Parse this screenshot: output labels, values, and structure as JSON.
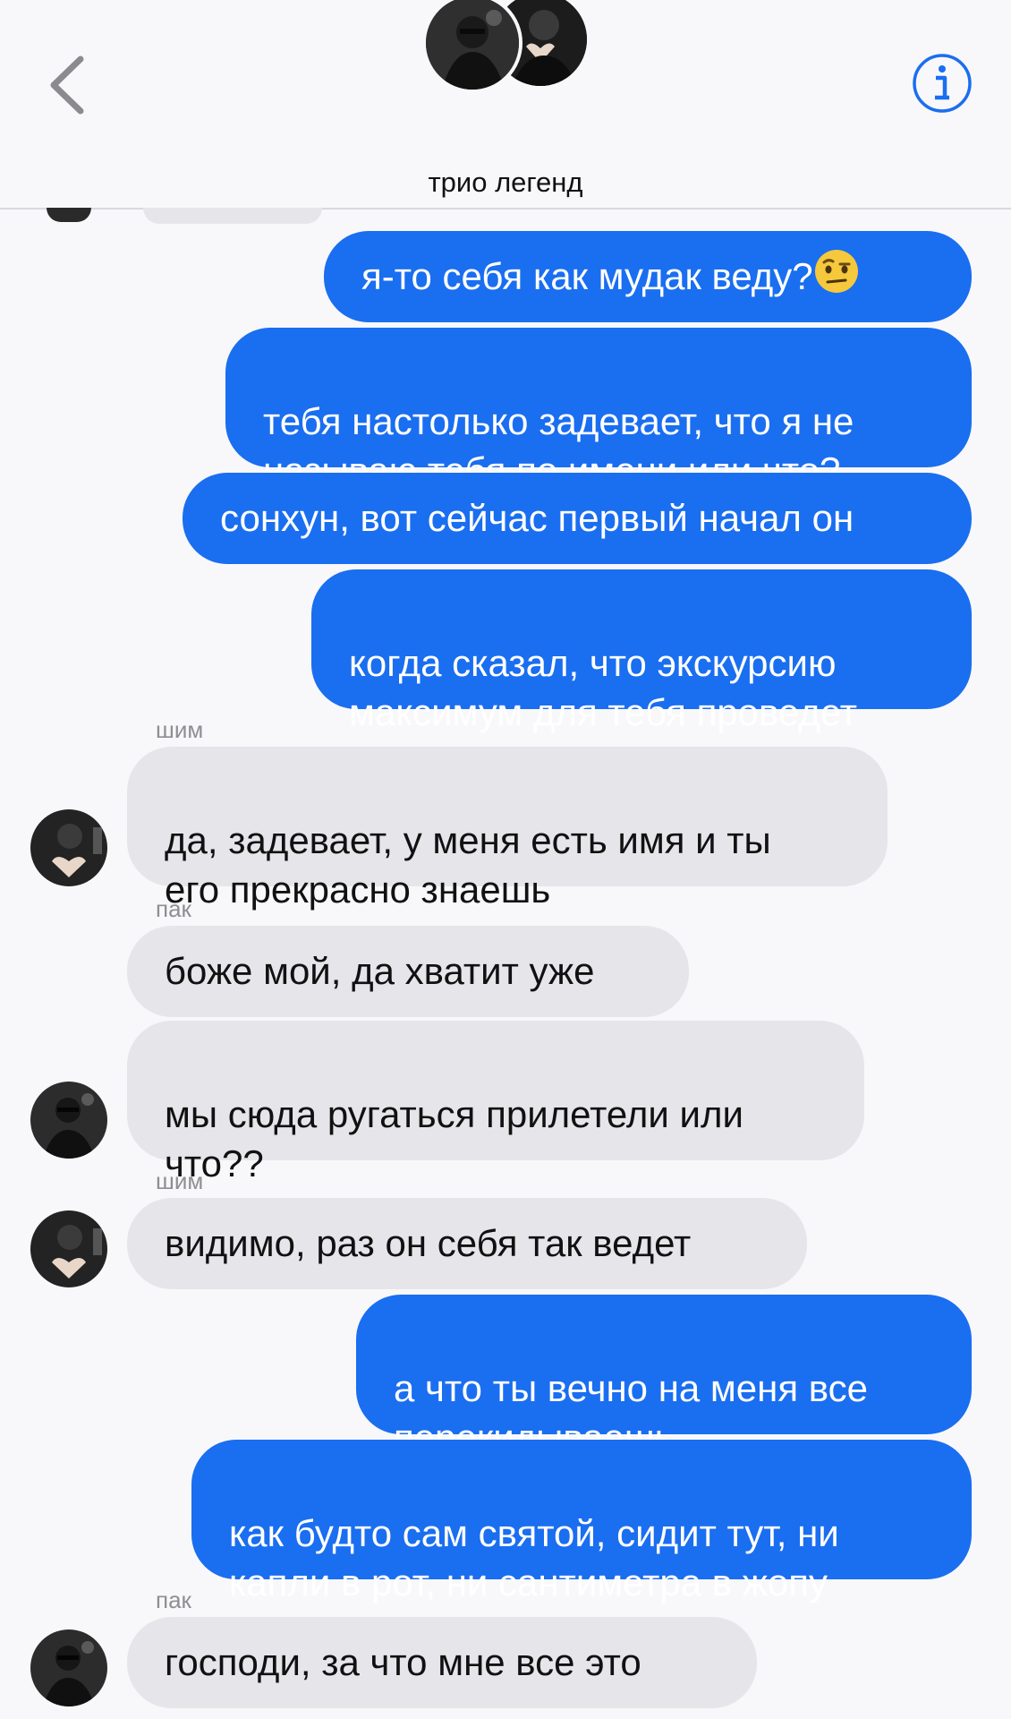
{
  "header": {
    "title": "трио легенд"
  },
  "messages": [
    {
      "dir": "out",
      "text": "я-то себя как мудак веду?"
    },
    {
      "dir": "out",
      "text": "тебя настолько задевает, что я не\nназываю тебя по имени или что?"
    },
    {
      "dir": "out",
      "text": "сонхун, вот сейчас первый начал он"
    },
    {
      "dir": "out",
      "text": "когда сказал, что экскурсию\nмаксимум для тебя проведет"
    },
    {
      "dir": "in",
      "sender": "шим",
      "text": "да, задевает, у меня есть имя и ты\nего прекрасно знаешь"
    },
    {
      "dir": "in",
      "sender": "пак",
      "text": "боже мой, да хватит уже"
    },
    {
      "dir": "in",
      "text": "мы сюда ругаться прилетели или\nчто??"
    },
    {
      "dir": "in",
      "sender": "шим",
      "text": "видимо, раз он себя так ведет"
    },
    {
      "dir": "out",
      "text": "а что ты вечно на меня все\nперекидываешь"
    },
    {
      "dir": "out",
      "text": "как будто сам святой, сидит тут, ни\nкапли в рот, ни сантиметра в жопу"
    },
    {
      "dir": "in",
      "sender": "пак",
      "text": "господи, за что мне все это"
    }
  ],
  "colors": {
    "outgoing_bubble": "#1a6ef0",
    "incoming_bubble": "#e6e6ea",
    "accent": "#1a6ef0"
  },
  "icons": {
    "back": "chevron-left-icon",
    "info": "info-icon",
    "emoji": "raised-eyebrow-emoji"
  }
}
